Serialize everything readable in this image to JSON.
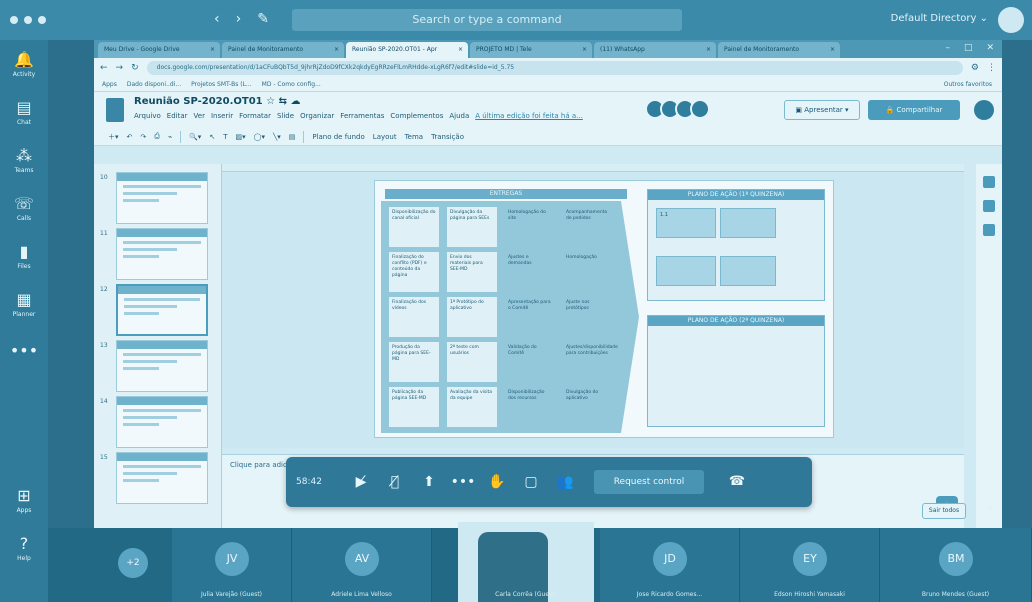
{
  "teams": {
    "search_placeholder": "Search or type a command",
    "directory": "Default Directory",
    "rail": [
      {
        "icon": "bell-icon",
        "glyph": "🔔",
        "label": "Activity"
      },
      {
        "icon": "chat-icon",
        "glyph": "▤",
        "label": "Chat"
      },
      {
        "icon": "teams-icon",
        "glyph": "⁂",
        "label": "Teams"
      },
      {
        "icon": "calls-icon",
        "glyph": "☏",
        "label": "Calls"
      },
      {
        "icon": "files-icon",
        "glyph": "▮",
        "label": "Files"
      },
      {
        "icon": "planner-icon",
        "glyph": "▦",
        "label": "Planner"
      },
      {
        "icon": "more-icon",
        "glyph": "•••",
        "label": ""
      }
    ],
    "rail_bottom": [
      {
        "icon": "apps-icon",
        "glyph": "⊞",
        "label": "Apps"
      },
      {
        "icon": "help-icon",
        "glyph": "?",
        "label": "Help"
      }
    ]
  },
  "browser": {
    "tabs": [
      {
        "label": "Meu Drive - Google Drive",
        "active": false
      },
      {
        "label": "Painel de Monitoramento",
        "active": false
      },
      {
        "label": "Reunião SP-2020.OT01 - Apr",
        "active": true
      },
      {
        "label": "PROJETO MD | Tele",
        "active": false
      },
      {
        "label": "(11) WhatsApp",
        "active": false
      },
      {
        "label": "Painel de Monitoramento",
        "active": false
      }
    ],
    "url": "docs.google.com/presentation/d/1aCFuBQbT5d_9jhrRjZdoD9fCXk2qkdyEgRRzeFlLmRHdde-xLgR6f7/edit#slide=id_5.75",
    "bookmarks": [
      "Apps",
      "Dado disponi..di...",
      "Projetos SMT-Bs (L...",
      "MD - Como config..."
    ],
    "other_bookmarks": "Outros favoritos"
  },
  "slides": {
    "title": "Reunião SP-2020.OT01",
    "menu": [
      "Arquivo",
      "Editar",
      "Ver",
      "Inserir",
      "Formatar",
      "Slide",
      "Organizar",
      "Ferramentas",
      "Complementos",
      "Ajuda"
    ],
    "last_edit": "A última edição foi feita há a...",
    "present": "Apresentar",
    "share": "Compartilhar",
    "toolbar": [
      "Plano de fundo",
      "Layout",
      "Tema",
      "Transição"
    ],
    "thumb_numbers": [
      "10",
      "11",
      "12",
      "13",
      "14",
      "15"
    ],
    "notes_placeholder": "Clique para adicionar notas do apresentador",
    "slide_content": {
      "entregas_title": "ENTREGAS",
      "cells": [
        "Disponibilização do canal oficial",
        "Divulgação da página para SEEs",
        "Homologação do site",
        "Acompanhamento de pedidos",
        "Finalização do conflito (PDF) e conteúdo da página",
        "Envio dos materiais para SEE-MD",
        "Ajustes e demandas",
        "Homologação",
        "Finalização dos vídeos",
        "1ª Protótipo do aplicativo",
        "Apresentação para o Comitê",
        "Ajuste nos protótipos",
        "Produção da página para SEE-MD",
        "2ª teste com usuários",
        "Validação do Comitê",
        "Ajustes/disponibilidade para contribuições",
        "Publicação da página SEE-MD",
        "Avaliação da visita da equipe",
        "Disponibilização dos recursos",
        "Divulgação do aplicativo"
      ],
      "plano1_title": "PLANO DE AÇÃO (1ª QUINZENA)",
      "plano1_box": "1.1",
      "plano2_title": "PLANO DE AÇÃO (2ª QUINZENA)"
    }
  },
  "meeting": {
    "timer": "58:42",
    "request_control": "Request control",
    "sair_tudo": "Sair todos",
    "more_participants": "+2",
    "participants": [
      {
        "initials": "JV",
        "name": "Julia Varejão (Guest)"
      },
      {
        "initials": "AV",
        "name": "Adriele Lima Velloso"
      },
      {
        "initials": "",
        "name": "Carla Corrêa (Guest)"
      },
      {
        "initials": "JD",
        "name": "Jose Ricardo Gomes..."
      },
      {
        "initials": "EY",
        "name": "Edson Hiroshi Yamasaki"
      },
      {
        "initials": "BM",
        "name": "Bruno Mendes (Guest)"
      }
    ]
  },
  "colors": {
    "tint": "#2b6f8c",
    "accent": "#4b9cbc"
  }
}
